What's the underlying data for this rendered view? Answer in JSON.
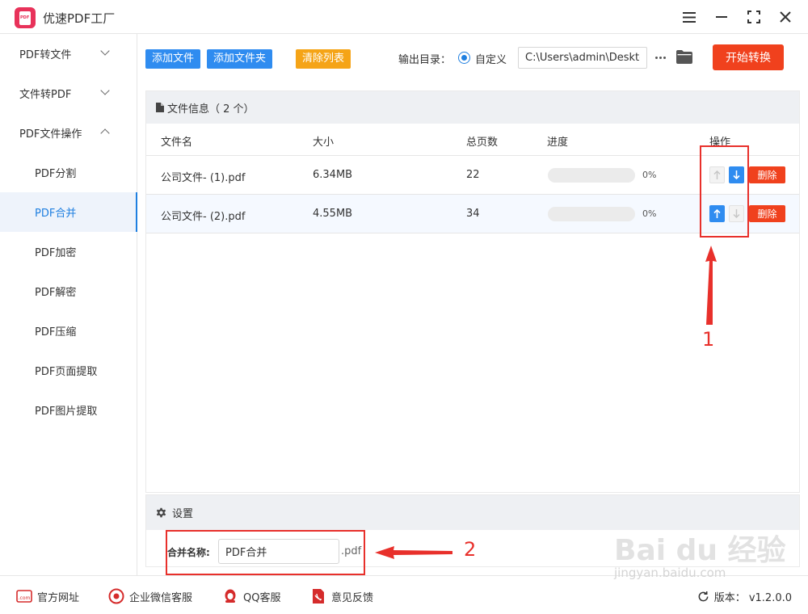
{
  "app": {
    "title": "优速PDF工厂"
  },
  "sidebar": {
    "groups": [
      {
        "label": "PDF转文件",
        "expanded": false
      },
      {
        "label": "文件转PDF",
        "expanded": false
      },
      {
        "label": "PDF文件操作",
        "expanded": true
      }
    ],
    "sub_items": [
      "PDF分割",
      "PDF合并",
      "PDF加密",
      "PDF解密",
      "PDF压缩",
      "PDF页面提取",
      "PDF图片提取"
    ],
    "active_item": "PDF合并"
  },
  "toolbar": {
    "add_file": "添加文件",
    "add_folder": "添加文件夹",
    "clear_list": "清除列表",
    "output_label": "输出目录：",
    "radio_label": "自定义",
    "output_path": "C:\\Users\\admin\\Deskto",
    "start_button": "开始转换",
    "accent_blue": "#2f8cf0",
    "accent_orange": "#f5a417",
    "accent_red": "#f0411d"
  },
  "file_panel": {
    "header": "文件信息（ 2 个）",
    "columns": [
      "文件名",
      "大小",
      "总页数",
      "进度",
      "操作"
    ],
    "rows": [
      {
        "name": "公司文件- (1).pdf",
        "size": "6.34MB",
        "pages": "22",
        "progress": 0,
        "progress_text": "0%",
        "up_enabled": false,
        "down_enabled": true
      },
      {
        "name": "公司文件- (2).pdf",
        "size": "4.55MB",
        "pages": "34",
        "progress": 0,
        "progress_text": "0%",
        "up_enabled": true,
        "down_enabled": false
      }
    ],
    "delete_label": "删除"
  },
  "settings": {
    "header": "设置",
    "merge_label": "合并名称:",
    "merge_value": "PDF合并",
    "merge_ext": ".pdf"
  },
  "footer": {
    "items": [
      "官方网址",
      "企业微信客服",
      "QQ客服",
      "意见反馈"
    ],
    "version": "版本：  v1.2.0.0"
  },
  "annotations": {
    "label_1": "1",
    "label_2": "2"
  },
  "watermark": {
    "line1": "Bai du 经验",
    "line2": "jingyan.baidu.com"
  }
}
